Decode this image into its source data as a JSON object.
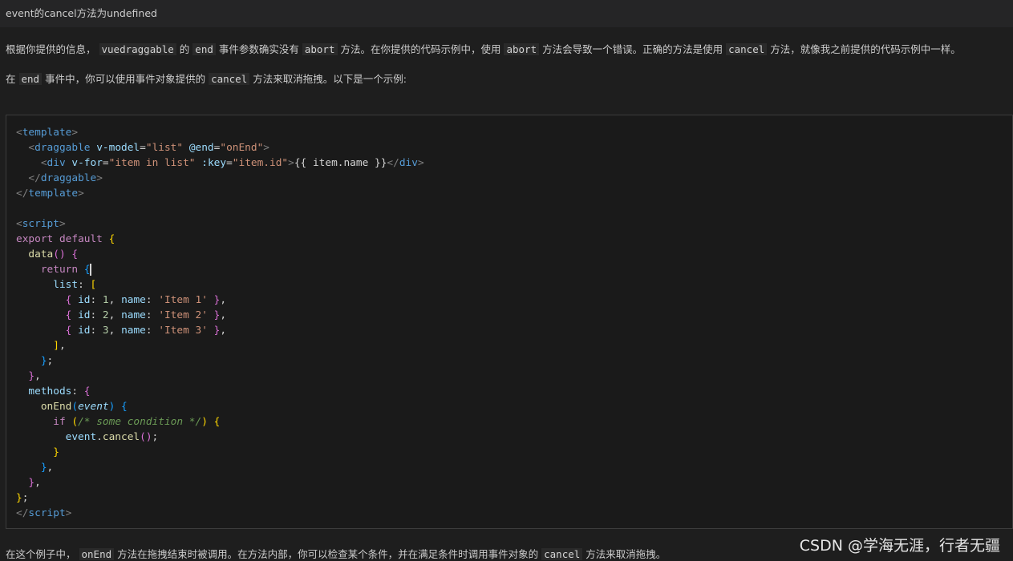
{
  "header": {
    "title": "event的cancel方法为undefined"
  },
  "para1": {
    "t1": "根据你提供的信息，",
    "c1": "vuedraggable",
    "t2": "的",
    "c2": "end",
    "t3": "事件参数确实没有",
    "c3": "abort",
    "t4": "方法。在你提供的代码示例中，使用",
    "c4": "abort",
    "t5": "方法会导致一个错误。正确的方法是使用",
    "c5": "cancel",
    "t6": "方法，就像我之前提供的代码示例中一样。"
  },
  "para2": {
    "t1": "在",
    "c1": "end",
    "t2": "事件中，你可以使用事件对象提供的",
    "c2": "cancel",
    "t3": "方法来取消拖拽。以下是一个示例:"
  },
  "para3": {
    "t1": "在这个例子中，",
    "c1": "onEnd",
    "t2": "方法在拖拽结束时被调用。在方法内部，你可以检查某个条件，并在满足条件时调用事件对象的",
    "c2": "cancel",
    "t3": "方法来取消拖拽。"
  },
  "watermark": {
    "text": "CSDN @学海无涯，行者无疆"
  }
}
